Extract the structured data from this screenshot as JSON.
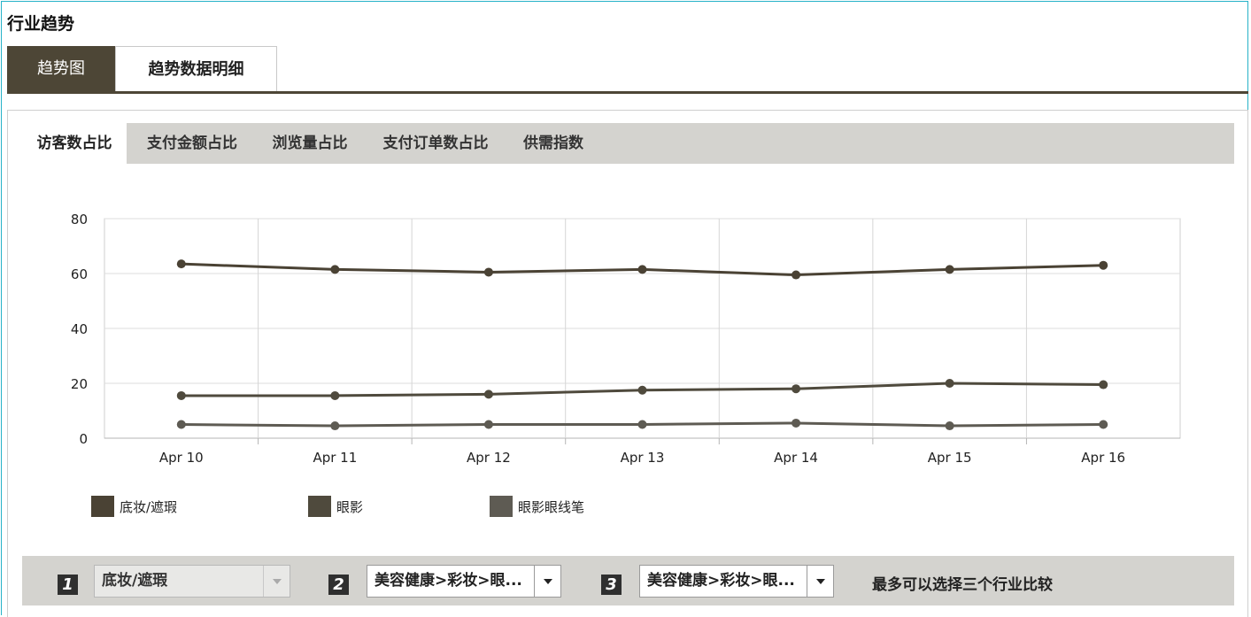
{
  "section_title": "行业趋势",
  "main_tabs": [
    {
      "label": "趋势图",
      "active": true
    },
    {
      "label": "趋势数据明细",
      "active": false
    }
  ],
  "sub_tabs": [
    {
      "label": "访客数占比",
      "active": true
    },
    {
      "label": "支付金额占比",
      "active": false
    },
    {
      "label": "浏览量占比",
      "active": false
    },
    {
      "label": "支付订单数占比",
      "active": false
    },
    {
      "label": "供需指数",
      "active": false
    }
  ],
  "chart_data": {
    "type": "line",
    "categories": [
      "Apr 10",
      "Apr 11",
      "Apr 12",
      "Apr 13",
      "Apr 14",
      "Apr 15",
      "Apr 16"
    ],
    "ylim": [
      0,
      80
    ],
    "yticks": [
      0,
      20,
      40,
      60,
      80
    ],
    "grid": true,
    "legend_position": "bottom-left",
    "series": [
      {
        "name": "底妆/遮瑕",
        "color": "#4a4234",
        "values": [
          63.5,
          61.5,
          60.5,
          61.5,
          59.5,
          61.5,
          63
        ]
      },
      {
        "name": "眼影",
        "color": "#4f4a3d",
        "values": [
          15.5,
          15.5,
          16,
          17.5,
          18,
          20,
          19.5
        ]
      },
      {
        "name": "眼影眼线笔",
        "color": "#5e5b53",
        "values": [
          5,
          4.5,
          5,
          5,
          5.5,
          4.5,
          5
        ]
      }
    ]
  },
  "selectors": [
    {
      "number": "1",
      "value": "底妆/遮瑕",
      "disabled": true
    },
    {
      "number": "2",
      "value": "美容健康>彩妆>眼...",
      "disabled": false
    },
    {
      "number": "3",
      "value": "美容健康>彩妆>眼...",
      "disabled": false
    }
  ],
  "hint": "最多可以选择三个行业比较"
}
